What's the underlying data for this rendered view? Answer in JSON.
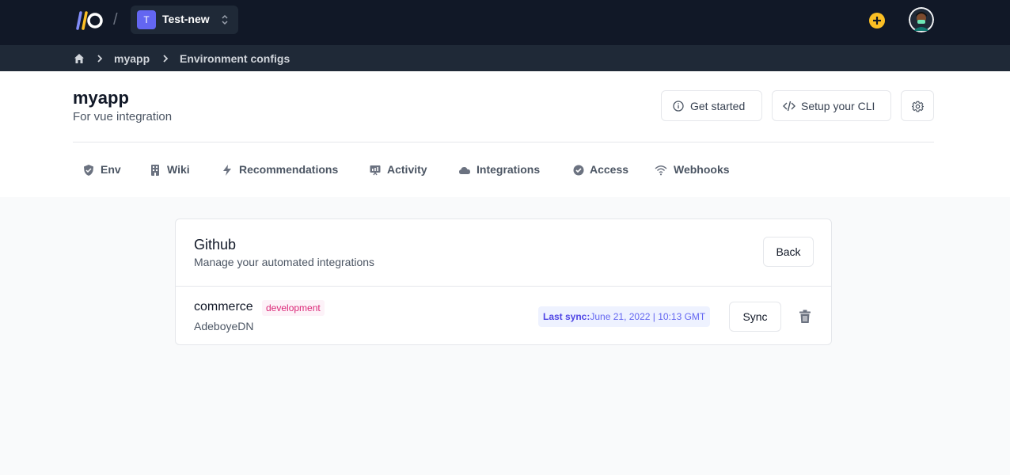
{
  "topbar": {
    "separator": "/",
    "project": {
      "initial": "T",
      "name": "Test-new"
    },
    "colors": {
      "accent": "#6366f1",
      "add": "#fbbf24",
      "background": "#111827"
    }
  },
  "breadcrumb": {
    "items": [
      {
        "label": "myapp"
      },
      {
        "label": "Environment configs"
      }
    ]
  },
  "app": {
    "title": "myapp",
    "subtitle": "For vue integration",
    "buttons": {
      "get_started": "Get started",
      "setup_cli": "Setup your CLI"
    }
  },
  "tabs": [
    {
      "label": "Env",
      "icon": "shield-icon"
    },
    {
      "label": "Wiki",
      "icon": "book-icon"
    },
    {
      "label": "Recommendations",
      "icon": "lightning-icon"
    },
    {
      "label": "Activity",
      "icon": "presentation-icon"
    },
    {
      "label": "Integrations",
      "icon": "cloud-icon"
    },
    {
      "label": "Access",
      "icon": "badge-check-icon"
    },
    {
      "label": "Webhooks",
      "icon": "wifi-icon"
    }
  ],
  "integration": {
    "title": "Github",
    "subtitle": "Manage your automated integrations",
    "back_label": "Back",
    "item": {
      "repo": "commerce",
      "environment": "development",
      "owner": "AdeboyeDN",
      "last_sync_label": "Last sync:",
      "last_sync_value": "June 21, 2022 | 10:13 GMT",
      "sync_label": "Sync"
    }
  }
}
